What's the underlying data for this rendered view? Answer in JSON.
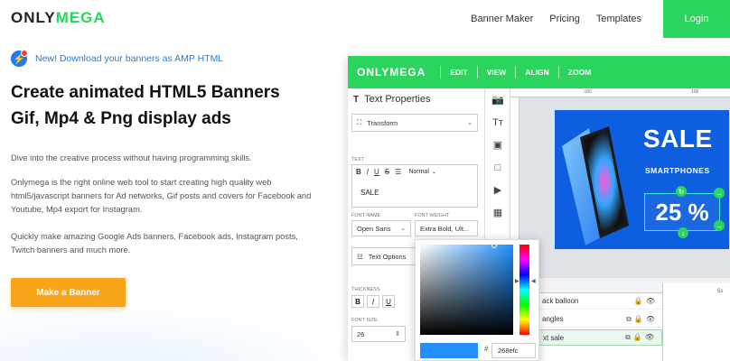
{
  "brand": {
    "only": "ONLY",
    "mega": "MEGA"
  },
  "nav": {
    "items": [
      "Banner Maker",
      "Pricing",
      "Templates"
    ],
    "login": "Login"
  },
  "hero": {
    "announcement": "New! Download your banners as AMP HTML",
    "title_line1": "Create animated HTML5 Banners",
    "title_line2": "Gif, Mp4 & Png display ads",
    "para1": "Dive into the creative process without having programming skills.",
    "para2": "Onlymega is the right online web tool to start creating high quality web html5/javascript banners for Ad networks, Gif posts and covers for Facebook and Youtube, Mp4 export for Instagram.",
    "para3": "Quickly make amazing Google Ads banners, Facebook ads, Instagram posts, Twitch banners and much more.",
    "cta": "Make a Banner"
  },
  "app": {
    "menu": [
      "EDIT",
      "VIEW",
      "ALIGN",
      "ZOOM"
    ],
    "panel_title": "Text Properties",
    "transform": "Transform",
    "text_label": "TEXT",
    "text_style": "Normal",
    "text_value": "SALE",
    "font_name_label": "FONT NAME",
    "font_weight_label": "FONT WEIGHT",
    "font_name": "Open Sans",
    "font_weight": "Extra Bold, Ult...",
    "text_options": "Text Options",
    "thickness_label": "THICKNESS",
    "font_size_label": "FONT SIZE",
    "font_size": "26",
    "ruler_ticks": [
      "-100",
      "100"
    ],
    "banner": {
      "sale": "SALE",
      "smartphones": "SMARTPHONES",
      "percent": "25 %"
    },
    "layers": [
      "ack balloon",
      "angles",
      "xt sale"
    ],
    "timeline_ticks": [
      "5s"
    ],
    "picker": {
      "hex": "268efc",
      "hash": "#"
    }
  },
  "colors": {
    "accent": "#2bd45c",
    "cta": "#f8a51a",
    "link": "#1d7cf0",
    "banner": "#0d5fe0",
    "picked": "#268efc"
  }
}
